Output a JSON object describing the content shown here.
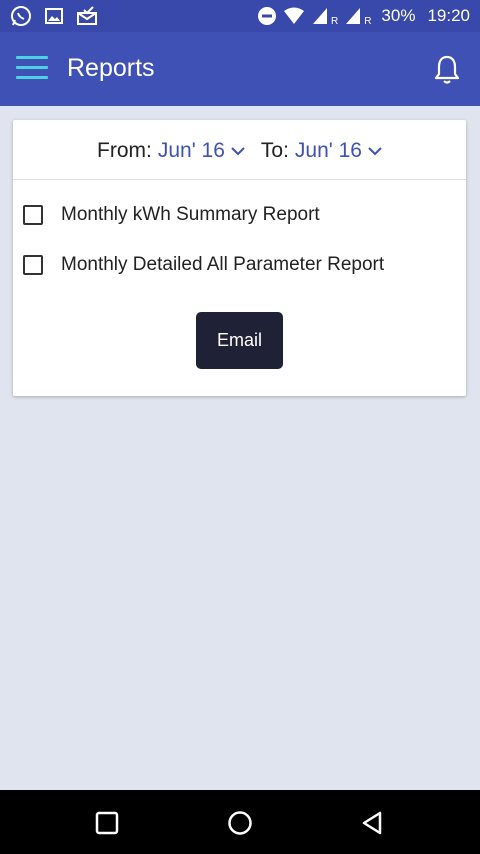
{
  "status_bar": {
    "battery": "30%",
    "time": "19:20",
    "signal_label_1": "R",
    "signal_label_2": "R",
    "left_icons": [
      "whatsapp-icon",
      "image-icon",
      "mail-check-icon"
    ]
  },
  "appbar": {
    "title": "Reports",
    "menu_icon": "hamburger-menu-icon",
    "notification_icon": "bell-icon"
  },
  "range": {
    "from_label": "From:",
    "from_value": "Jun' 16",
    "to_label": "To:",
    "to_value": "Jun' 16"
  },
  "options": [
    {
      "label": "Monthly kWh Summary Report",
      "checked": false
    },
    {
      "label": "Monthly Detailed All Parameter Report",
      "checked": false
    }
  ],
  "email_button": "Email",
  "colors": {
    "appbar": "#3f51b5",
    "status_bar": "#3949ab",
    "accent": "#4dd0e1",
    "background": "#dfe4ee",
    "button": "#1f2137"
  }
}
